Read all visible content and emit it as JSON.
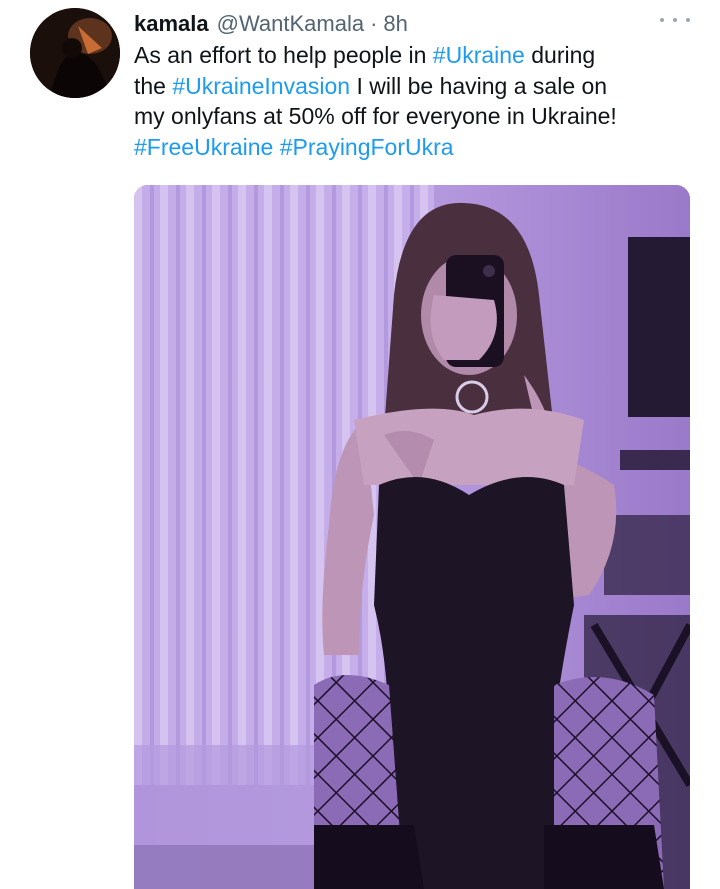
{
  "tweet": {
    "author": {
      "display_name": "kamala",
      "handle": "@WantKamala",
      "separator": "·",
      "time": "8h",
      "avatar_icon": "avatar-photo"
    },
    "more_icon": "more-options-icon",
    "text": {
      "line1_pre": "As an effort to help people in ",
      "line1_tag": "#Ukraine",
      "line1_post": " during",
      "line2_pre": "the ",
      "line2_tag": "#UkraineInvasion",
      "line2_post": " I will be having a sale on",
      "line3": "my onlyfans at 50% off for everyone in Ukraine!",
      "tag4": "#FreeUkraine",
      "tag5": "#PrayingForUkra"
    },
    "media": {
      "type": "photo",
      "tint": "#a27fd1"
    }
  },
  "colors": {
    "link": "#1d9bf0",
    "text": "#0f1419",
    "secondary": "#536471"
  }
}
